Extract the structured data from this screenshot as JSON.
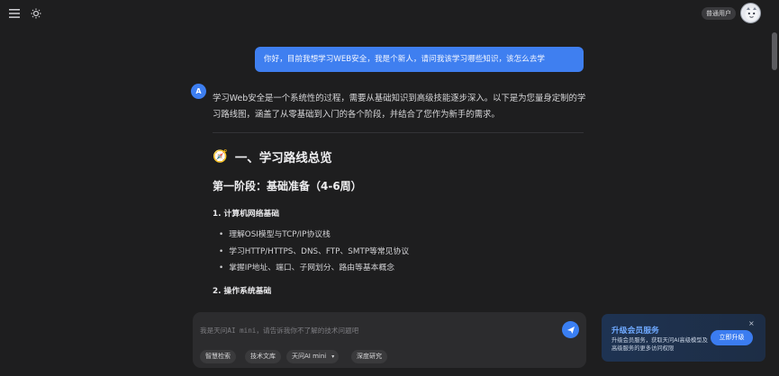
{
  "topbar": {
    "menu_icon": "menu-icon",
    "theme_icon": "sun-icon",
    "user_badge": "普通用户",
    "avatar_icon": "avatar-icon"
  },
  "chat": {
    "user_message": "你好，目前我想学习WEB安全，我是个新人，请问我该学习哪些知识，该怎么去学",
    "ai_avatar_letter": "A",
    "intro": "学习Web安全是一个系统性的过程，需要从基础知识到高级技能逐步深入。以下是为您量身定制的学习路线图，涵盖了从零基础到入门的各个阶段，并结合了您作为新手的需求。",
    "section_title": "一、学习路线总览",
    "section_emoji": "🧭",
    "phase_title": "第一阶段：基础准备（4-6周）",
    "topic1": "1. 计算机网络基础",
    "topic1_items": [
      "理解OSI模型与TCP/IP协议栈",
      "学习HTTP/HTTPS、DNS、FTP、SMTP等常见协议",
      "掌握IP地址、端口、子网划分、路由等基本概念"
    ],
    "topic2": "2. 操作系统基础"
  },
  "composer": {
    "placeholder": "我是天问AI mini，请告诉我你不了解的技术问题吧",
    "send_icon": "send-icon",
    "chips": {
      "smart_search": "智慧检索",
      "tech_library": "技术文库",
      "model_select": "天问AI mini",
      "deep_research": "深度研究"
    }
  },
  "promo": {
    "title": "升级会员服务",
    "desc": "升级会员服务，获取天问AI高级模型及高级服务的更多访问权限",
    "button": "立即升级",
    "close": "×"
  },
  "colors": {
    "background": "#1e1e1f",
    "accent": "#3f7ff0",
    "promo_title": "#6fa9ff"
  }
}
